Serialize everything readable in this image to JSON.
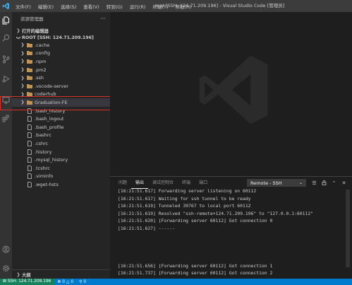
{
  "titlebar": {
    "menus": [
      "文件(F)",
      "编辑(E)",
      "选择(S)",
      "查看(V)",
      "转到(G)",
      "运行(R)",
      "终端(T)",
      "帮助(H)"
    ],
    "window_title": "root [SSH: 124.71.209.196] - Visual Studio Code [管理员]"
  },
  "activity": {
    "icons": [
      "files-icon",
      "search-icon",
      "source-control-icon",
      "run-debug-icon",
      "remote-explorer-icon",
      "extensions-icon"
    ],
    "bottom": [
      "account-icon",
      "settings-gear-icon"
    ]
  },
  "sidebar": {
    "title": "资源管理器",
    "more": "···",
    "open_editors": "打开的编辑器",
    "root": "ROOT [SSH: 124.71.209.196]",
    "outline": "大纲",
    "folders": [
      ".cache",
      ".config",
      ".npm",
      ".pm2",
      ".ssh",
      ".vscode-server",
      "coderhub",
      "Graduation-FE"
    ],
    "files": [
      ".bash_history",
      ".bash_logout",
      ".bash_profile",
      ".bashrc",
      ".cshrc",
      ".history",
      ".mysql_history",
      ".tcshrc",
      ".viminfo",
      ".wget-hsts"
    ]
  },
  "panel": {
    "tabs": [
      "问题",
      "输出",
      "调试控制台",
      "终端",
      "端口"
    ],
    "active_tab": "输出",
    "channel": "Remote - SSH",
    "output_lines_top": [
      "[16:21:51.617] Forwarding server listening on 60112",
      "[16:21:51.617] Waiting for ssh tunnel to be ready",
      "[16:21:51.619] Tunneled 39767 to local port 60112",
      "[16:21:51.619] Resolved \"ssh-remote+124.71.209.196\" to \"127.0.0.1:60112\"",
      "[16:21:51.620] [Forwarding server 60112] Got connection 0",
      "[16:21:51.627] ------"
    ],
    "output_lines_bottom": [
      "[16:21:51.656] [Forwarding server 60112] Got connection 1",
      "[16:21:51.737] [Forwarding server 60112] Got connection 2"
    ]
  },
  "statusbar": {
    "remote": "SSH: 124.71.209.196",
    "errors": "0",
    "warnings": "0",
    "ports": "0"
  },
  "colors": {
    "statusbar": "#007acc",
    "remote_badge": "#16825d",
    "highlight": "#d9302c",
    "folder": "#c09553"
  }
}
